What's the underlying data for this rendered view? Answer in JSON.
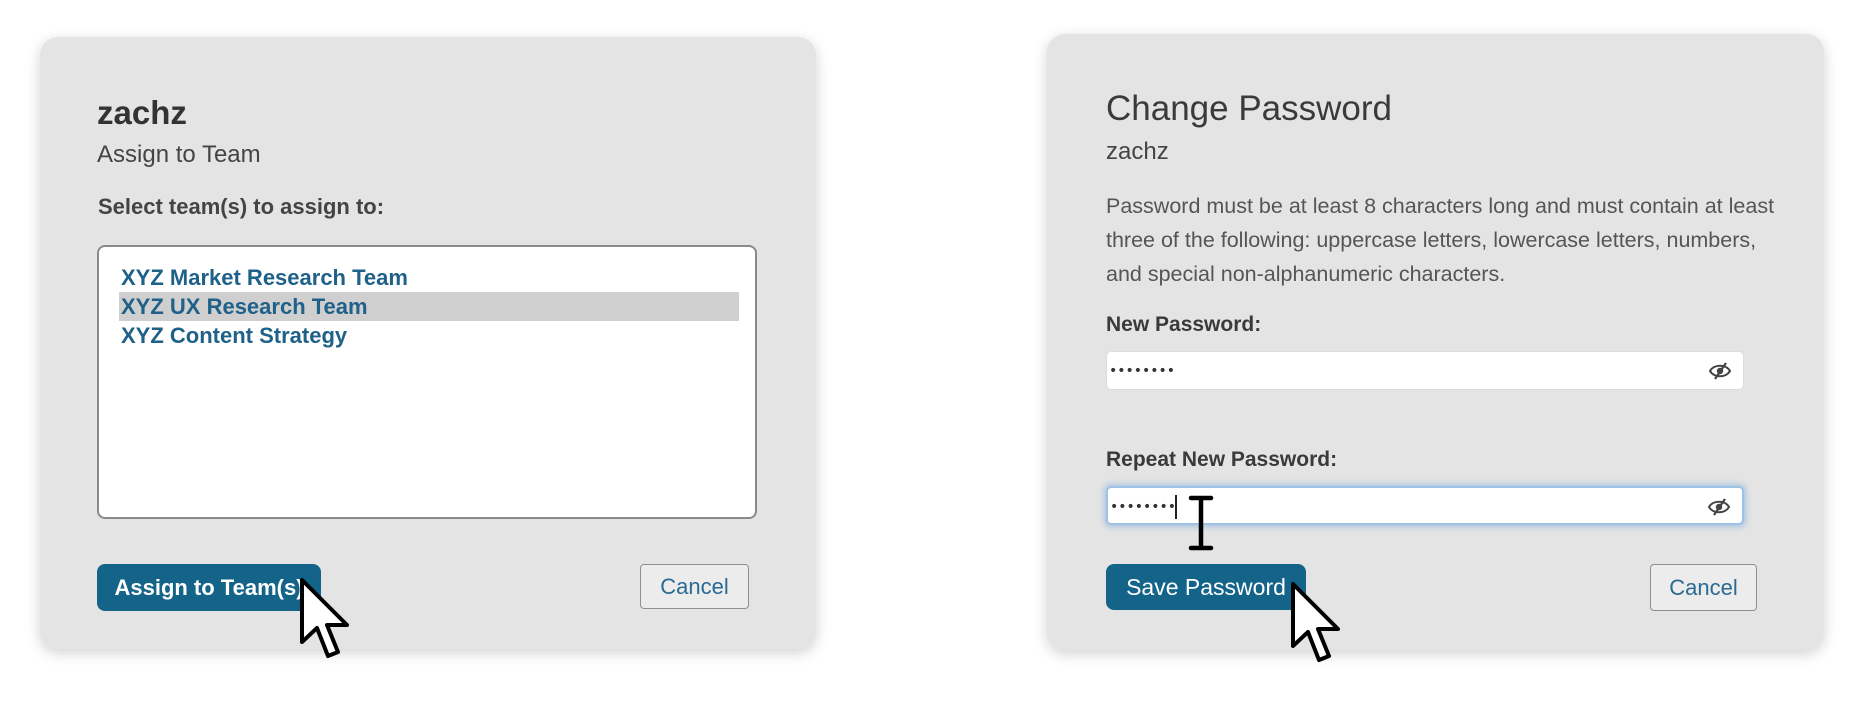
{
  "assign_dialog": {
    "title": "zachz",
    "subtitle": "Assign to Team",
    "select_label": "Select team(s) to assign to:",
    "teams": [
      {
        "label": "XYZ Market Research Team",
        "selected": false
      },
      {
        "label": "XYZ UX Research Team",
        "selected": true
      },
      {
        "label": "XYZ Content Strategy",
        "selected": false
      }
    ],
    "assign_button": "Assign to Team(s)",
    "cancel_button": "Cancel"
  },
  "password_dialog": {
    "title": "Change Password",
    "username": "zachz",
    "description": "Password must be at least 8 characters long and must contain at least three of the following: uppercase letters, lowercase letters, numbers, and special non-alphanumeric characters.",
    "new_password_label": "New Password:",
    "new_password_value": "••••••••",
    "repeat_password_label": "Repeat New Password:",
    "repeat_password_value": "••••••••",
    "save_button": "Save Password",
    "cancel_button": "Cancel"
  },
  "colors": {
    "primary_button": "#14648a",
    "link_text": "#1f6188",
    "card_background": "#e4e4e4",
    "selected_row": "#cfcfcf",
    "focus_ring": "#9dc2e6"
  },
  "icons": {
    "password_toggle": "eye-slash-icon",
    "pointer": "arrow-cursor-icon",
    "text_cursor": "i-beam-cursor-icon"
  }
}
